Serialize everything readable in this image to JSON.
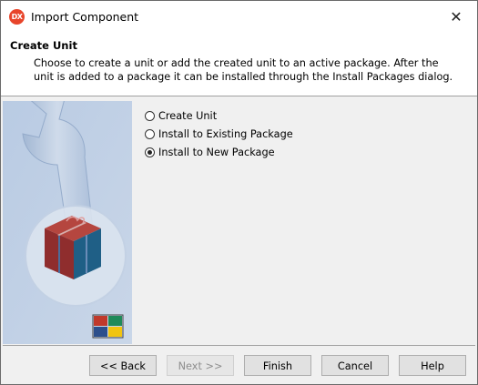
{
  "window": {
    "icon_text": "DX",
    "title": "Import Component",
    "close_symbol": "✕"
  },
  "header": {
    "title": "Create Unit",
    "description": "Choose to create a unit or add the created unit to an active package. After the unit is added to a package it can be installed through the Install Packages dialog."
  },
  "options": [
    {
      "label": "Create Unit",
      "selected": false
    },
    {
      "label": "Install to Existing Package",
      "selected": false
    },
    {
      "label": "Install to New Package",
      "selected": true
    }
  ],
  "buttons": {
    "back": "<< Back",
    "next": "Next >>",
    "finish": "Finish",
    "cancel": "Cancel",
    "help": "Help"
  },
  "colors": {
    "side_panel": "#aabfd9",
    "icon_bg": "#e8452b"
  }
}
